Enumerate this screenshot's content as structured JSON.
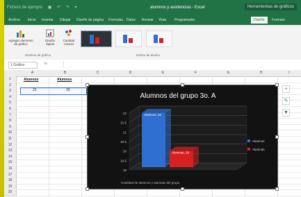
{
  "window": {
    "title": "alumnos y asistencias - Excel",
    "tools_label": "Herramientas de gráficos",
    "file_name_blurred": "Fichero de ejemplo"
  },
  "tabs": [
    {
      "label": "Archivo"
    },
    {
      "label": "Inicio"
    },
    {
      "label": "Insertar"
    },
    {
      "label": "Dibujar"
    },
    {
      "label": "Diseño de página"
    },
    {
      "label": "Fórmulas"
    },
    {
      "label": "Datos"
    },
    {
      "label": "Revisar"
    },
    {
      "label": "Vista"
    },
    {
      "label": "Programador"
    },
    {
      "label": "Diseño"
    },
    {
      "label": "Formato"
    }
  ],
  "ribbon": {
    "add_element": "Agregar elemento de gráfico",
    "quick_layout": "Diseño rápido",
    "change_colors": "Cambiar colores",
    "group_layouts": "Diseños de gráfico",
    "group_styles": "Estilos de diseño"
  },
  "formula_bar": {
    "name_box": "1 Gráfico",
    "fx": "fx"
  },
  "columns": [
    "A",
    "B",
    "C",
    "D",
    "E",
    "F",
    "G",
    "H",
    "I"
  ],
  "rows": [
    "1",
    "2",
    "3",
    "4",
    "5",
    "6",
    "7",
    "8",
    "9",
    "10",
    "11",
    "12",
    "13",
    "14",
    "15",
    "16",
    "17",
    "18",
    "19",
    "20"
  ],
  "cells": {
    "a1": "Alumnos",
    "b1": "Alumnos",
    "a2": "22",
    "b2": "20"
  },
  "colors": {
    "excel_green": "#217346",
    "bar_blue": "#2e6fd1",
    "bar_red": "#d82020"
  },
  "chart_data": {
    "type": "bar",
    "title": "Alumnos del grupo 3o. A",
    "xlabel": "Cantidad de alumnos y alumnas del grupo",
    "categories": [
      ""
    ],
    "series": [
      {
        "name": "Alumnos",
        "values": [
          22
        ],
        "data_label": "Alumnos, 22",
        "color": "#2e6fd1"
      },
      {
        "name": "Alumnas",
        "values": [
          20
        ],
        "data_label": "Alumnas, 20",
        "color": "#d82020"
      }
    ],
    "ylim": [
      19,
      22
    ],
    "y_ticks": [
      "22",
      "21.5",
      "21",
      "20.5",
      "20",
      "19.5",
      "19"
    ],
    "legend_position": "right",
    "grid": true,
    "style": "3d"
  }
}
